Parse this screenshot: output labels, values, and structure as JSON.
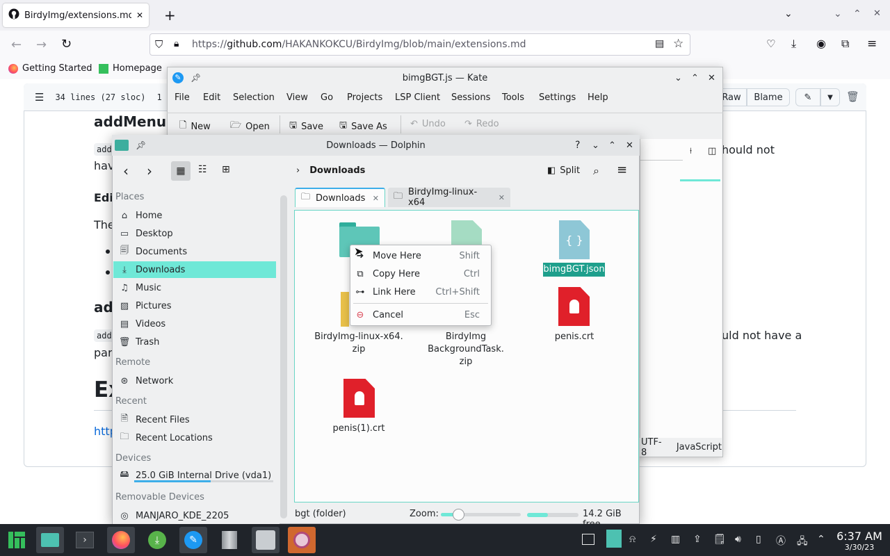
{
  "firefox": {
    "tab_title": "BirdyImg/extensions.md at",
    "url_prefix": "https://",
    "url_domain": "github.com",
    "url_path": "/HAKANKOKCU/BirdyImg/blob/main/extensions.md",
    "bookmarks": [
      "Getting Started",
      "Homepage"
    ]
  },
  "github": {
    "lines_info": "34 lines (27 sloc)",
    "lines_extra": "1",
    "raw_label": "Raw",
    "blame_label": "Blame",
    "heading1": "addMenuB",
    "code1": "add",
    "text_hav": "hav",
    "text_edi": "Edi",
    "text_the": "The",
    "heading2": "add",
    "code2": "add",
    "text_par": "par",
    "heading_ex": "Ex",
    "link_http": "http",
    "right_text1": "hould not",
    "right_text2": "uld not have a"
  },
  "kate": {
    "title": "bimgBGT.js — Kate",
    "menu": [
      "File",
      "Edit",
      "Selection",
      "View",
      "Go",
      "Projects",
      "LSP Client",
      "Sessions",
      "Tools",
      "Settings",
      "Help"
    ],
    "toolbar": {
      "new": "New",
      "open": "Open",
      "save": "Save",
      "save_as": "Save As",
      "undo": "Undo",
      "redo": "Redo"
    },
    "encoding": "UTF-8",
    "language": "JavaScript"
  },
  "dolphin": {
    "title": "Downloads — Dolphin",
    "breadcrumb": "Downloads",
    "split_label": "Split",
    "tabs": [
      "Downloads",
      "BirdyImg-linux-x64"
    ],
    "places_header": "Places",
    "places": [
      "Home",
      "Desktop",
      "Documents",
      "Downloads",
      "Music",
      "Pictures",
      "Videos",
      "Trash"
    ],
    "remote_header": "Remote",
    "remote": [
      "Network"
    ],
    "recent_header": "Recent",
    "recent": [
      "Recent Files",
      "Recent Locations"
    ],
    "devices_header": "Devices",
    "drive": "25.0 GiB Internal Drive (vda1)",
    "drive_usage": 0.55,
    "removable_header": "Removable Devices",
    "removable": "MANJARO_KDE_2205",
    "files": {
      "zip1": "BirdyImg-linux-x64.\nzip",
      "zip2": "BirdyImg\nBackgroundTask.\nzip",
      "json": "bimgBGT.json",
      "crt1": "penis.crt",
      "crt2": "penis(1).crt"
    },
    "status_text": "bgt (folder)",
    "zoom_label": "Zoom:",
    "zoom_level": 0.22,
    "free_fraction": 0.4,
    "free_space": "14.2 GiB free",
    "context_menu": [
      {
        "label": "Move Here",
        "shortcut": "Shift"
      },
      {
        "label": "Copy Here",
        "shortcut": "Ctrl"
      },
      {
        "label": "Link Here",
        "shortcut": "Ctrl+Shift"
      },
      {
        "label": "Cancel",
        "shortcut": "Esc"
      }
    ]
  },
  "taskbar": {
    "time": "6:37 AM",
    "date": "3/30/23"
  },
  "colors": {
    "accent": "#6fe8d7",
    "selection": "#1e9f8c",
    "crt_red": "#e0202a"
  }
}
